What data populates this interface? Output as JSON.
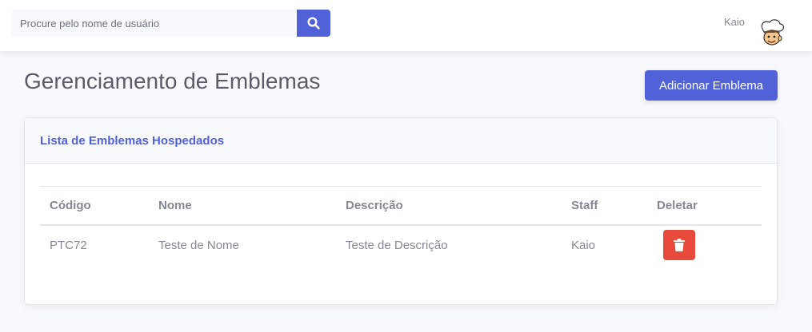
{
  "topbar": {
    "search": {
      "placeholder": "Procure pelo nome de usuário",
      "value": ""
    },
    "search_icon": "search-icon",
    "user": {
      "name": "Kaio",
      "avatar": "cartoon-chef-avatar"
    }
  },
  "page": {
    "title": "Gerenciamento de Emblemas",
    "add_button_label": "Adicionar Emblema"
  },
  "card": {
    "title": "Lista de Emblemas Hospedados",
    "columns": [
      "Código",
      "Nome",
      "Descrição",
      "Staff",
      "Deletar"
    ],
    "rows": [
      {
        "codigo": "PTC72",
        "nome": "Teste de Nome",
        "descricao": "Teste de Descrição",
        "staff": "Kaio",
        "delete_icon": "trash-icon"
      }
    ]
  },
  "colors": {
    "primary": "#5161d8",
    "danger": "#e74a3b",
    "background": "#f8f9fc",
    "text": "#858796"
  }
}
